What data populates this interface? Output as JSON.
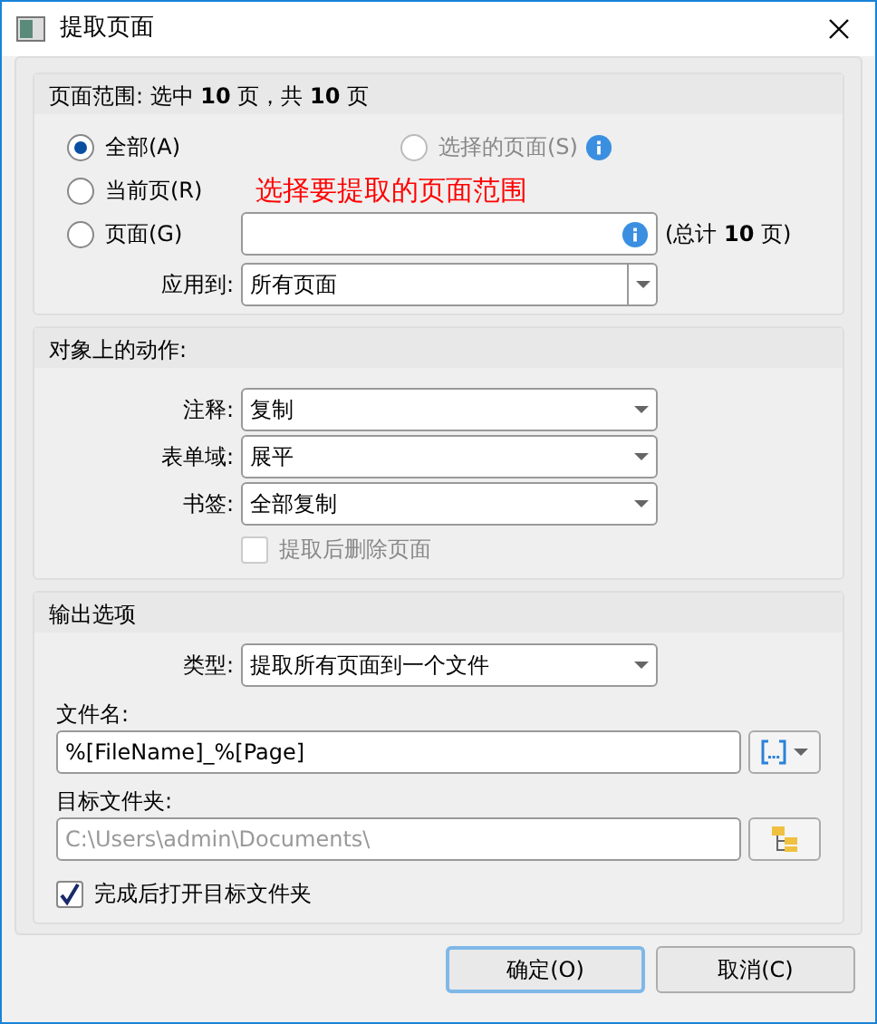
{
  "window": {
    "title": "提取页面"
  },
  "page_range": {
    "title": "页面范围: 选中 **10** 页，共 **10** 页",
    "options": [
      {
        "label": "全部(A)",
        "selected": true,
        "disabled": false
      },
      {
        "label": "选择的页面(S)",
        "selected": false,
        "disabled": true
      },
      {
        "label": "当前页(R)",
        "selected": false,
        "disabled": false
      },
      {
        "label": "页面(G)",
        "selected": false,
        "disabled": false
      }
    ],
    "hint": "选择要提取的页面范围",
    "total": "(总计 **10** 页)",
    "apply_to": {
      "label": "应用到:",
      "value": "所有页面"
    }
  },
  "actions": {
    "title": "对象上的动作:",
    "fields": [
      {
        "label": "注释:",
        "value": "复制"
      },
      {
        "label": "表单域:",
        "value": "展平"
      },
      {
        "label": "书签:",
        "value": "全部复制"
      }
    ],
    "delete_after": {
      "label": "提取后删除页面",
      "checked": false,
      "disabled": true
    }
  },
  "output": {
    "title": "输出选项",
    "type": {
      "label": "类型:",
      "value": "提取所有页面到一个文件"
    },
    "filename": {
      "label": "文件名:",
      "value": "%[FileName]_%[Page]"
    },
    "folder": {
      "label": "目标文件夹:",
      "value": "C:\\Users\\admin\\Documents\\",
      "disabled": true
    },
    "open_after": {
      "label": "完成后打开目标文件夹",
      "checked": true,
      "disabled": false
    }
  },
  "buttons": [
    {
      "label": "确定(O)",
      "default": true
    },
    {
      "label": "取消(C)",
      "default": false
    }
  ]
}
